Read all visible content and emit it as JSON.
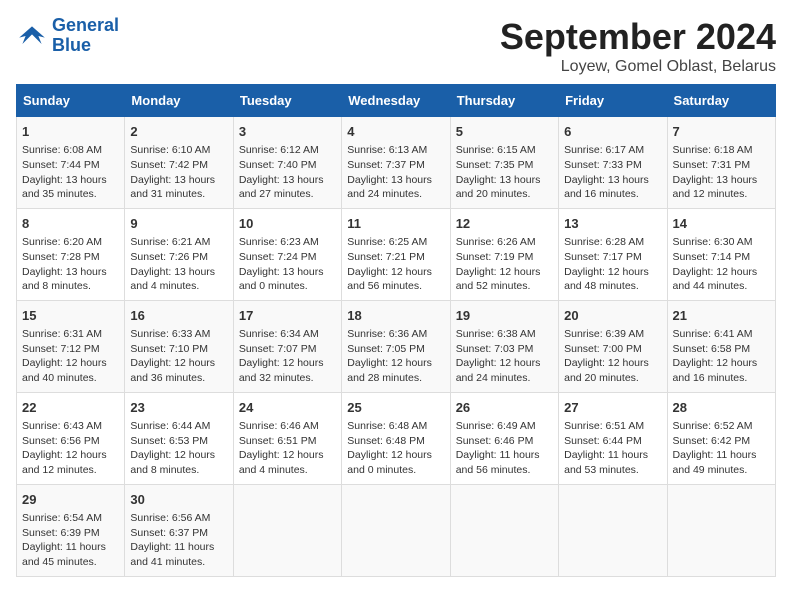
{
  "logo": {
    "line1": "General",
    "line2": "Blue"
  },
  "title": "September 2024",
  "subtitle": "Loyew, Gomel Oblast, Belarus",
  "days_of_week": [
    "Sunday",
    "Monday",
    "Tuesday",
    "Wednesday",
    "Thursday",
    "Friday",
    "Saturday"
  ],
  "weeks": [
    [
      {
        "day": "1",
        "rise": "Sunrise: 6:08 AM",
        "set": "Sunset: 7:44 PM",
        "daylight": "Daylight: 13 hours and 35 minutes."
      },
      {
        "day": "2",
        "rise": "Sunrise: 6:10 AM",
        "set": "Sunset: 7:42 PM",
        "daylight": "Daylight: 13 hours and 31 minutes."
      },
      {
        "day": "3",
        "rise": "Sunrise: 6:12 AM",
        "set": "Sunset: 7:40 PM",
        "daylight": "Daylight: 13 hours and 27 minutes."
      },
      {
        "day": "4",
        "rise": "Sunrise: 6:13 AM",
        "set": "Sunset: 7:37 PM",
        "daylight": "Daylight: 13 hours and 24 minutes."
      },
      {
        "day": "5",
        "rise": "Sunrise: 6:15 AM",
        "set": "Sunset: 7:35 PM",
        "daylight": "Daylight: 13 hours and 20 minutes."
      },
      {
        "day": "6",
        "rise": "Sunrise: 6:17 AM",
        "set": "Sunset: 7:33 PM",
        "daylight": "Daylight: 13 hours and 16 minutes."
      },
      {
        "day": "7",
        "rise": "Sunrise: 6:18 AM",
        "set": "Sunset: 7:31 PM",
        "daylight": "Daylight: 13 hours and 12 minutes."
      }
    ],
    [
      {
        "day": "8",
        "rise": "Sunrise: 6:20 AM",
        "set": "Sunset: 7:28 PM",
        "daylight": "Daylight: 13 hours and 8 minutes."
      },
      {
        "day": "9",
        "rise": "Sunrise: 6:21 AM",
        "set": "Sunset: 7:26 PM",
        "daylight": "Daylight: 13 hours and 4 minutes."
      },
      {
        "day": "10",
        "rise": "Sunrise: 6:23 AM",
        "set": "Sunset: 7:24 PM",
        "daylight": "Daylight: 13 hours and 0 minutes."
      },
      {
        "day": "11",
        "rise": "Sunrise: 6:25 AM",
        "set": "Sunset: 7:21 PM",
        "daylight": "Daylight: 12 hours and 56 minutes."
      },
      {
        "day": "12",
        "rise": "Sunrise: 6:26 AM",
        "set": "Sunset: 7:19 PM",
        "daylight": "Daylight: 12 hours and 52 minutes."
      },
      {
        "day": "13",
        "rise": "Sunrise: 6:28 AM",
        "set": "Sunset: 7:17 PM",
        "daylight": "Daylight: 12 hours and 48 minutes."
      },
      {
        "day": "14",
        "rise": "Sunrise: 6:30 AM",
        "set": "Sunset: 7:14 PM",
        "daylight": "Daylight: 12 hours and 44 minutes."
      }
    ],
    [
      {
        "day": "15",
        "rise": "Sunrise: 6:31 AM",
        "set": "Sunset: 7:12 PM",
        "daylight": "Daylight: 12 hours and 40 minutes."
      },
      {
        "day": "16",
        "rise": "Sunrise: 6:33 AM",
        "set": "Sunset: 7:10 PM",
        "daylight": "Daylight: 12 hours and 36 minutes."
      },
      {
        "day": "17",
        "rise": "Sunrise: 6:34 AM",
        "set": "Sunset: 7:07 PM",
        "daylight": "Daylight: 12 hours and 32 minutes."
      },
      {
        "day": "18",
        "rise": "Sunrise: 6:36 AM",
        "set": "Sunset: 7:05 PM",
        "daylight": "Daylight: 12 hours and 28 minutes."
      },
      {
        "day": "19",
        "rise": "Sunrise: 6:38 AM",
        "set": "Sunset: 7:03 PM",
        "daylight": "Daylight: 12 hours and 24 minutes."
      },
      {
        "day": "20",
        "rise": "Sunrise: 6:39 AM",
        "set": "Sunset: 7:00 PM",
        "daylight": "Daylight: 12 hours and 20 minutes."
      },
      {
        "day": "21",
        "rise": "Sunrise: 6:41 AM",
        "set": "Sunset: 6:58 PM",
        "daylight": "Daylight: 12 hours and 16 minutes."
      }
    ],
    [
      {
        "day": "22",
        "rise": "Sunrise: 6:43 AM",
        "set": "Sunset: 6:56 PM",
        "daylight": "Daylight: 12 hours and 12 minutes."
      },
      {
        "day": "23",
        "rise": "Sunrise: 6:44 AM",
        "set": "Sunset: 6:53 PM",
        "daylight": "Daylight: 12 hours and 8 minutes."
      },
      {
        "day": "24",
        "rise": "Sunrise: 6:46 AM",
        "set": "Sunset: 6:51 PM",
        "daylight": "Daylight: 12 hours and 4 minutes."
      },
      {
        "day": "25",
        "rise": "Sunrise: 6:48 AM",
        "set": "Sunset: 6:48 PM",
        "daylight": "Daylight: 12 hours and 0 minutes."
      },
      {
        "day": "26",
        "rise": "Sunrise: 6:49 AM",
        "set": "Sunset: 6:46 PM",
        "daylight": "Daylight: 11 hours and 56 minutes."
      },
      {
        "day": "27",
        "rise": "Sunrise: 6:51 AM",
        "set": "Sunset: 6:44 PM",
        "daylight": "Daylight: 11 hours and 53 minutes."
      },
      {
        "day": "28",
        "rise": "Sunrise: 6:52 AM",
        "set": "Sunset: 6:42 PM",
        "daylight": "Daylight: 11 hours and 49 minutes."
      }
    ],
    [
      {
        "day": "29",
        "rise": "Sunrise: 6:54 AM",
        "set": "Sunset: 6:39 PM",
        "daylight": "Daylight: 11 hours and 45 minutes."
      },
      {
        "day": "30",
        "rise": "Sunrise: 6:56 AM",
        "set": "Sunset: 6:37 PM",
        "daylight": "Daylight: 11 hours and 41 minutes."
      },
      {
        "day": "",
        "rise": "",
        "set": "",
        "daylight": ""
      },
      {
        "day": "",
        "rise": "",
        "set": "",
        "daylight": ""
      },
      {
        "day": "",
        "rise": "",
        "set": "",
        "daylight": ""
      },
      {
        "day": "",
        "rise": "",
        "set": "",
        "daylight": ""
      },
      {
        "day": "",
        "rise": "",
        "set": "",
        "daylight": ""
      }
    ]
  ]
}
